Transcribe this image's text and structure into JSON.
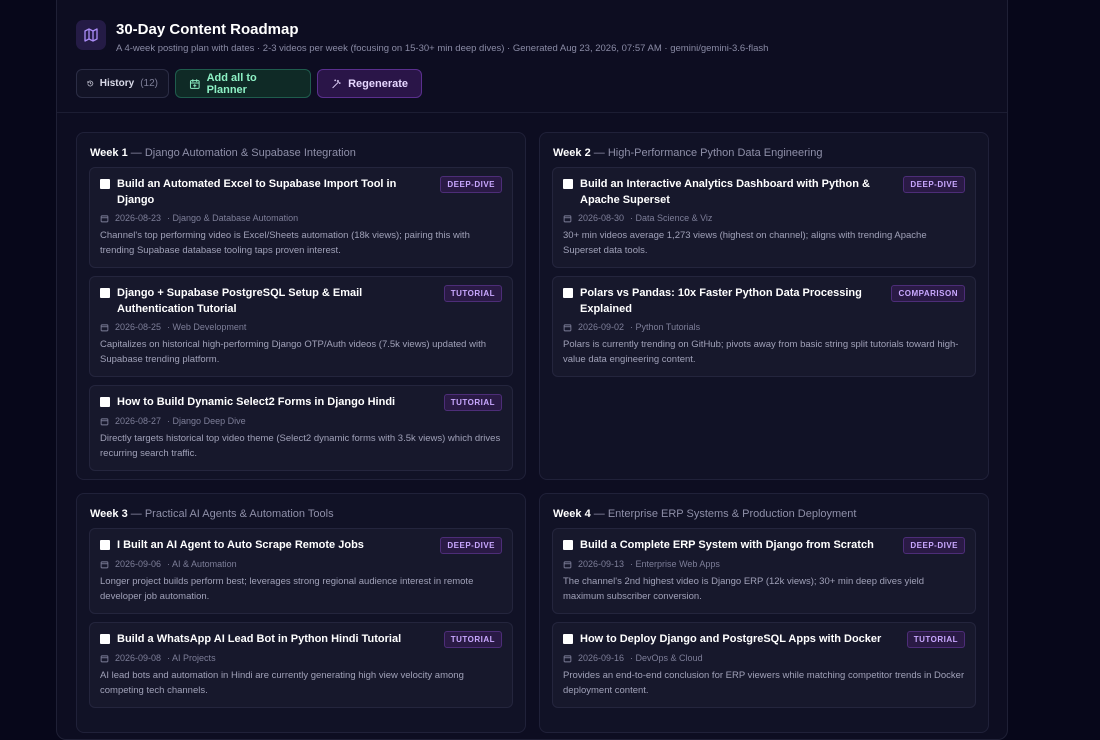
{
  "header": {
    "title": "30-Day Content Roadmap",
    "subtitle": "A 4-week posting plan with dates · 2-3 videos per week (focusing on 15-30+ min deep dives) · Generated Aug 23, 2026, 07:57 AM · gemini/gemini-3.6-flash",
    "logo_icon": "map-icon"
  },
  "actions": {
    "history_label": "History",
    "history_count": "(12)",
    "planner_label": "Add all to Planner",
    "regenerate_label": "Regenerate"
  },
  "colors": {
    "accent_purple": "#c9a8ff",
    "accent_green": "#8df0c4",
    "background": "#07071a"
  },
  "weeks": [
    {
      "label": "Week 1",
      "theme": "— Django Automation & Supabase Integration",
      "items": [
        {
          "title": "Build an Automated Excel to Supabase Import Tool in Django",
          "tag": "DEEP-DIVE",
          "date": "2026-08-23",
          "category": "· Django & Database Automation",
          "desc": "Channel's top performing video is Excel/Sheets automation (18k views); pairing this with trending Supabase database tooling taps proven interest."
        },
        {
          "title": "Django + Supabase PostgreSQL Setup & Email Authentication Tutorial",
          "tag": "TUTORIAL",
          "date": "2026-08-25",
          "category": "· Web Development",
          "desc": "Capitalizes on historical high-performing Django OTP/Auth videos (7.5k views) updated with Supabase trending platform."
        },
        {
          "title": "How to Build Dynamic Select2 Forms in Django Hindi",
          "tag": "TUTORIAL",
          "date": "2026-08-27",
          "category": "· Django Deep Dive",
          "desc": "Directly targets historical top video theme (Select2 dynamic forms with 3.5k views) which drives recurring search traffic."
        }
      ]
    },
    {
      "label": "Week 2",
      "theme": "— High-Performance Python Data Engineering",
      "items": [
        {
          "title": "Build an Interactive Analytics Dashboard with Python & Apache Superset",
          "tag": "DEEP-DIVE",
          "date": "2026-08-30",
          "category": "· Data Science & Viz",
          "desc": "30+ min videos average 1,273 views (highest on channel); aligns with trending Apache Superset data tools."
        },
        {
          "title": "Polars vs Pandas: 10x Faster Python Data Processing Explained",
          "tag": "COMPARISON",
          "date": "2026-09-02",
          "category": "· Python Tutorials",
          "desc": "Polars is currently trending on GitHub; pivots away from basic string split tutorials toward high-value data engineering content."
        }
      ]
    },
    {
      "label": "Week 3",
      "theme": "— Practical AI Agents & Automation Tools",
      "items": [
        {
          "title": "I Built an AI Agent to Auto Scrape Remote Jobs",
          "tag": "DEEP-DIVE",
          "date": "2026-09-06",
          "category": "· AI & Automation",
          "desc": "Longer project builds perform best; leverages strong regional audience interest in remote developer job automation."
        },
        {
          "title": "Build a WhatsApp AI Lead Bot in Python Hindi Tutorial",
          "tag": "TUTORIAL",
          "date": "2026-09-08",
          "category": "· AI Projects",
          "desc": "AI lead bots and automation in Hindi are currently generating high view velocity among competing tech channels."
        }
      ]
    },
    {
      "label": "Week 4",
      "theme": "— Enterprise ERP Systems & Production Deployment",
      "items": [
        {
          "title": "Build a Complete ERP System with Django from Scratch",
          "tag": "DEEP-DIVE",
          "date": "2026-09-13",
          "category": "· Enterprise Web Apps",
          "desc": "The channel's 2nd highest video is Django ERP (12k views); 30+ min deep dives yield maximum subscriber conversion."
        },
        {
          "title": "How to Deploy Django and PostgreSQL Apps with Docker",
          "tag": "TUTORIAL",
          "date": "2026-09-16",
          "category": "· DevOps & Cloud",
          "desc": "Provides an end-to-end conclusion for ERP viewers while matching competitor trends in Docker deployment content."
        }
      ]
    }
  ]
}
